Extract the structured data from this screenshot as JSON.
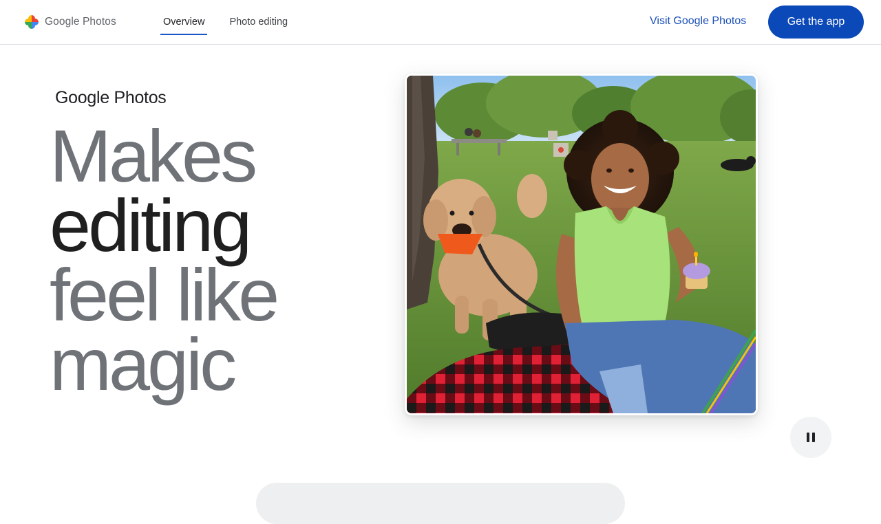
{
  "brand": {
    "name": "Google Photos",
    "colors": {
      "red": "#ea4335",
      "yellow": "#fbbc04",
      "green": "#34a853",
      "blue": "#4285f4"
    }
  },
  "nav": {
    "tabs": [
      {
        "label": "Overview",
        "active": true
      },
      {
        "label": "Photo editing",
        "active": false
      }
    ],
    "visit_link": "Visit Google Photos",
    "cta": "Get the app",
    "accent": "#0b48b8"
  },
  "hero": {
    "logo_text": "Google Photos",
    "headline": [
      "Makes",
      "editing",
      "feel like",
      "magic"
    ],
    "emphasized_line": "editing",
    "image": "photo of a smiling woman sitting on a red checkered blanket in a park with a poodle, holding a cupcake",
    "media_control": {
      "icon": "pause-icon",
      "state": "playing"
    }
  }
}
